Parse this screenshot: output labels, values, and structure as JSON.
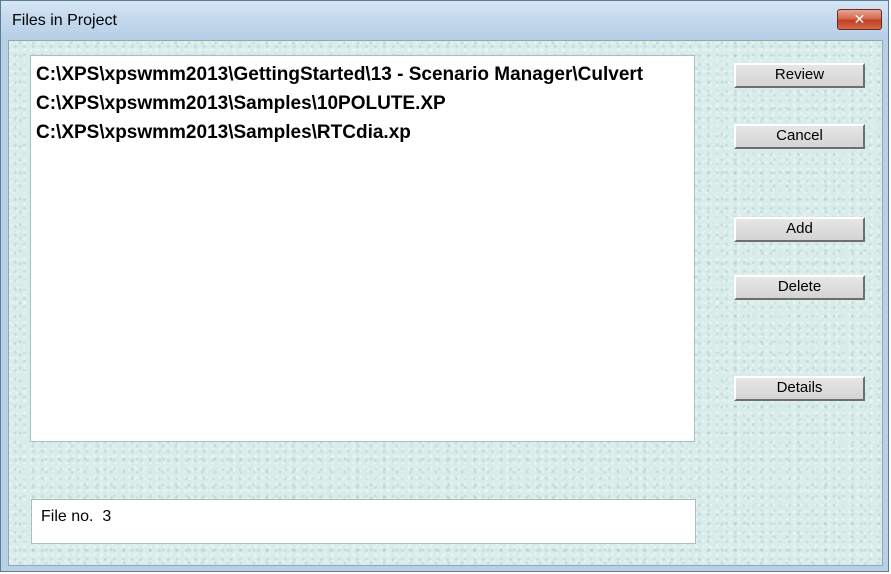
{
  "window": {
    "title": "Files in Project",
    "close_symbol": "✕",
    "close_icon": "close-icon"
  },
  "file_list": {
    "items": [
      "C:\\XPS\\xpswmm2013\\GettingStarted\\13 - Scenario Manager\\Culvert",
      "C:\\XPS\\xpswmm2013\\Samples\\10POLUTE.XP",
      "C:\\XPS\\xpswmm2013\\Samples\\RTCdia.xp"
    ]
  },
  "buttons": {
    "review": "Review",
    "cancel": "Cancel",
    "add": "Add",
    "delete": "Delete",
    "details": "Details"
  },
  "status": {
    "text": "File no.  3"
  },
  "colors": {
    "title_bar": "#c3d8ec",
    "client_background": "#d8ece9",
    "close_button": "#c13f22"
  }
}
